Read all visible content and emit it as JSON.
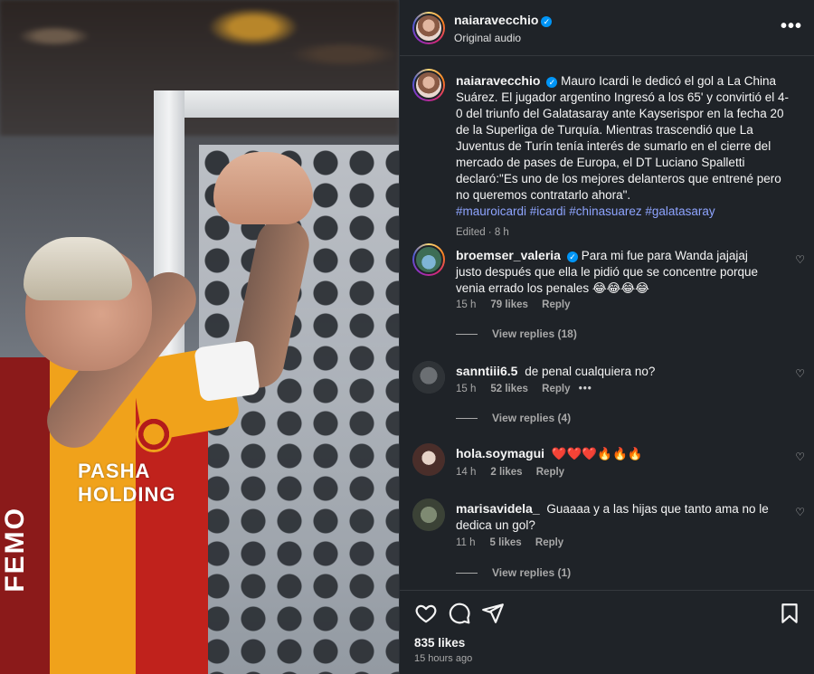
{
  "header": {
    "username": "naiaravecchio",
    "subtitle": "Original audio",
    "more_icon": "•••"
  },
  "media": {
    "sponsor_line1": "PASHA",
    "sponsor_line2": "HOLDING",
    "side_text": "FEMO"
  },
  "caption": {
    "username": "naiaravecchio",
    "text": "Mauro Icardi le dedicó el gol a La China Suárez. El jugador argentino Ingresó a los 65' y convirtió el 4-0 del triunfo del Galatasaray ante Kayserispor en la fecha 20 de la Superliga de Turquía. Mientras trascendió que La Juventus de Turín tenía interés de sumarlo en el cierre del mercado de pases de Europa, el DT Luciano Spalletti declaró:\"Es uno de los mejores delanteros que entrené pero no queremos contratarlo ahora\".",
    "hashtags": "#mauroicardi #icardi #chinasuarez #galatasaray",
    "meta": "Edited · 8 h"
  },
  "comments": [
    {
      "username": "broemser_valeria",
      "verified": true,
      "text": "Para mi fue para Wanda jajajaj justo después que ella le pidió que se concentre porque venia errado los penales 😂😂😂😂",
      "time": "15 h",
      "likes": "79 likes",
      "reply": "Reply",
      "view_replies": "View replies (18)"
    },
    {
      "username": "sanntiii6.5",
      "verified": false,
      "text": "de penal cualquiera no?",
      "time": "15 h",
      "likes": "52 likes",
      "reply": "Reply",
      "dots": "•••",
      "view_replies": "View replies (4)"
    },
    {
      "username": "hola.soymagui",
      "verified": false,
      "text": "❤️❤️❤️🔥🔥🔥",
      "time": "14 h",
      "likes": "2 likes",
      "reply": "Reply"
    },
    {
      "username": "marisavidela_",
      "verified": false,
      "text": "Guaaaa y a las hijas que tanto ama no le dedica un gol?",
      "time": "11 h",
      "likes": "5 likes",
      "reply": "Reply",
      "view_replies": "View replies (1)"
    }
  ],
  "footer": {
    "likes": "835 likes",
    "time_ago": "15 hours ago"
  },
  "icons": [
    "heart-icon",
    "comment-icon",
    "share-icon",
    "bookmark-icon",
    "verified-badge-icon",
    "more-icon"
  ],
  "colors": {
    "panel_bg": "#1f2328",
    "link": "#8ea4ff",
    "verified": "#0095f6",
    "muted": "#a8a8a8"
  }
}
